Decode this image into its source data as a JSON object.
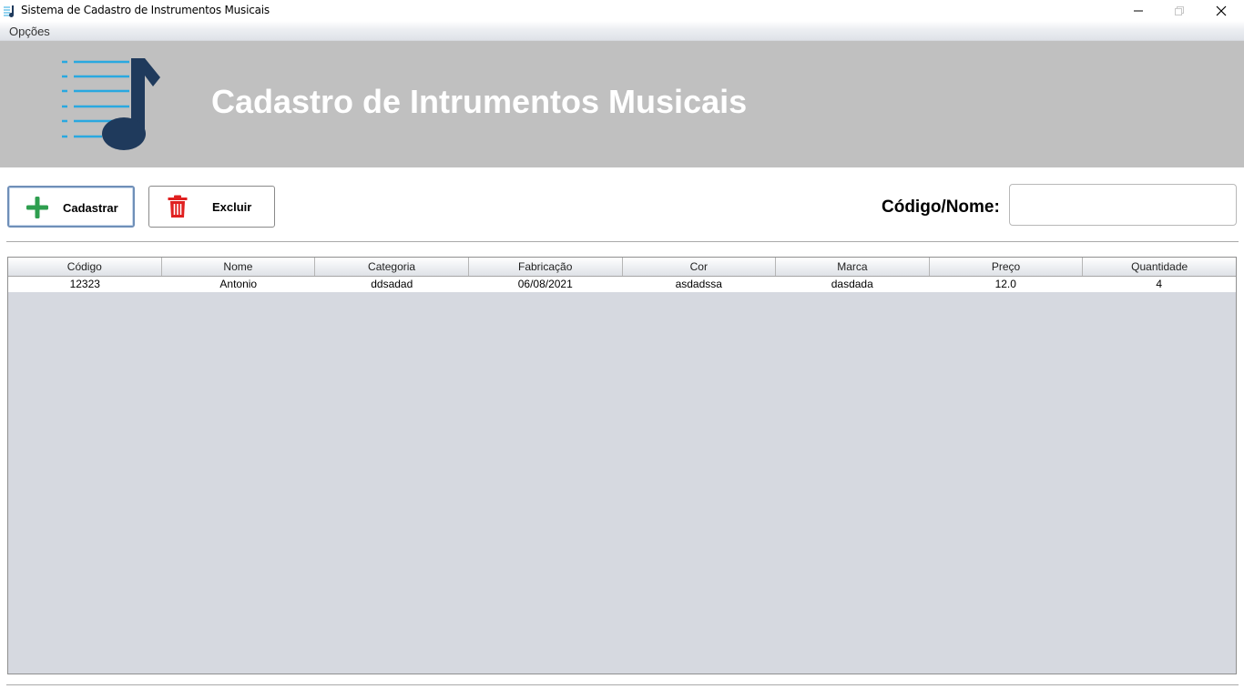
{
  "window": {
    "title": "Sistema de Cadastro de Instrumentos Musicais"
  },
  "menu": {
    "items": [
      "Opções"
    ]
  },
  "banner": {
    "title": "Cadastro de Intrumentos Musicais",
    "logo_icon": "music-note-list-icon"
  },
  "toolbar": {
    "add_label": "Cadastrar",
    "add_icon": "plus-icon",
    "delete_label": "Excluir",
    "delete_icon": "trash-icon",
    "search_label": "Código/Nome:",
    "search_value": ""
  },
  "table": {
    "columns": [
      "Código",
      "Nome",
      "Categoria",
      "Fabricação",
      "Cor",
      "Marca",
      "Preço",
      "Quantidade"
    ],
    "rows": [
      [
        "12323",
        "Antonio",
        "ddsadad",
        "06/08/2021",
        "asdadssa",
        "dasdada",
        "12.0",
        "4"
      ]
    ]
  },
  "colors": {
    "banner_bg": "#c0c0c0",
    "table_bg": "#d6d9e0",
    "add_green": "#2e9e4f",
    "delete_red": "#e02020",
    "logo_dark": "#1f3a5c",
    "logo_lines": "#29a8e0"
  }
}
